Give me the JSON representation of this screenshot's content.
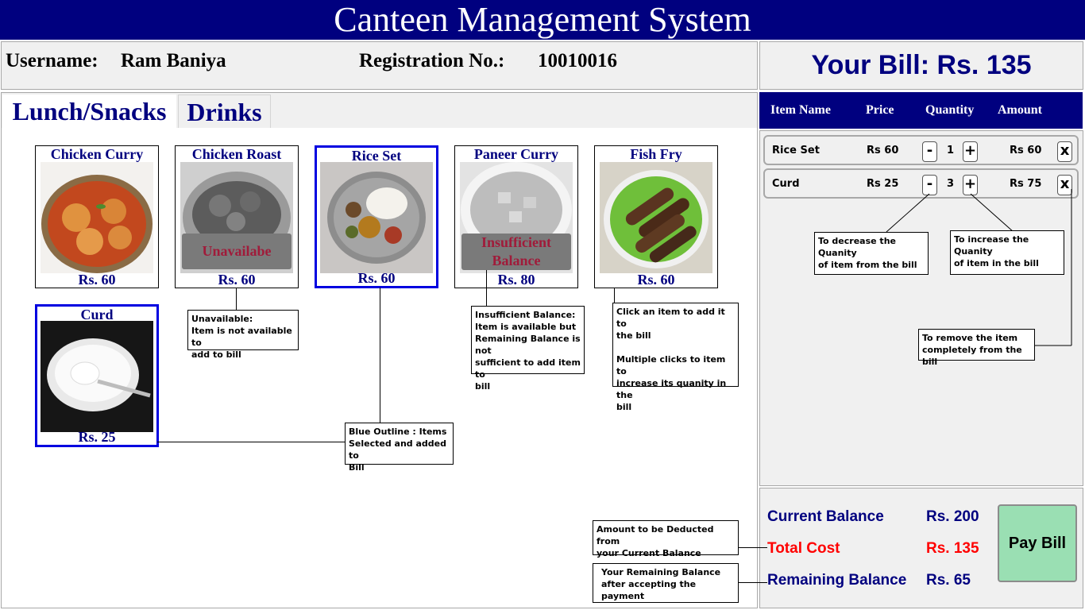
{
  "app": {
    "title": "Canteen Management System"
  },
  "user": {
    "username_label": "Username:",
    "username": "Ram Baniya",
    "reg_label": "Registration No.:",
    "reg_no": "10010016"
  },
  "bill": {
    "heading": "Your Bill: Rs. 135"
  },
  "tabs": [
    {
      "label": "Lunch/Snacks",
      "active": true
    },
    {
      "label": "Drinks",
      "active": false
    }
  ],
  "menu_items": [
    {
      "name": "Chicken Curry",
      "price": "Rs. 60",
      "state": "available",
      "icon": "chicken-curry-image"
    },
    {
      "name": "Chicken Roast",
      "price": "Rs. 60",
      "state": "unavailable",
      "overlay": "Unavailabe",
      "icon": "chicken-roast-image"
    },
    {
      "name": "Rice Set",
      "price": "Rs. 60",
      "state": "selected",
      "icon": "rice-set-image"
    },
    {
      "name": "Paneer Curry",
      "price": "Rs. 80",
      "state": "insufficient",
      "overlay": "Insufficient Balance",
      "icon": "paneer-curry-image"
    },
    {
      "name": "Fish Fry",
      "price": "Rs. 60",
      "state": "available",
      "icon": "fish-fry-image"
    },
    {
      "name": "Curd",
      "price": "Rs. 25",
      "state": "selected",
      "icon": "curd-image"
    }
  ],
  "notes": {
    "unavailable": [
      "Unavailable:",
      "Item is not available to",
      "add to bill"
    ],
    "insufficient": [
      "Insufficient Balance:",
      "Item is available but",
      "Remaining Balance is not",
      "sufficient to add item to",
      "bill"
    ],
    "click": [
      "Click an item to add it to",
      "the bill",
      "",
      "Multiple clicks to item to",
      "increase its quanity in the",
      "bill"
    ],
    "blue": [
      "Blue Outline : Items",
      "Selected and added to",
      "Bill"
    ],
    "decrease": [
      "To decrease the Quanity",
      "of item from the bill"
    ],
    "increase": [
      "To increase the Quanity",
      "of item in the bill"
    ],
    "remove": [
      "To remove the item",
      "completely from the bill"
    ],
    "deduct": [
      "Amount to be Deducted from",
      "your Current Balance"
    ],
    "remaining": [
      "Your Remaining Balance",
      "after accepting the",
      "payment"
    ]
  },
  "bill_table": {
    "headers": [
      "Item Name",
      "Price",
      "Quantity",
      "Amount"
    ],
    "rows": [
      {
        "item": "Rice Set",
        "price": "Rs 60",
        "qty": "1",
        "amount": "Rs 60"
      },
      {
        "item": "Curd",
        "price": "Rs 25",
        "qty": "3",
        "amount": "Rs 75"
      }
    ],
    "minus": "-",
    "plus": "+",
    "remove": "x"
  },
  "totals": {
    "current_label": "Current Balance",
    "current_value": "Rs. 200",
    "total_label": "Total Cost",
    "total_value": "Rs. 135",
    "remaining_label": "Remaining Balance",
    "remaining_value": "Rs. 65",
    "pay_label": "Pay Bill"
  },
  "colors": {
    "header_blue": "#00007f",
    "selected_outline": "#0000e0",
    "cost_red": "#ff0000",
    "pay_green": "#9adfb3"
  }
}
